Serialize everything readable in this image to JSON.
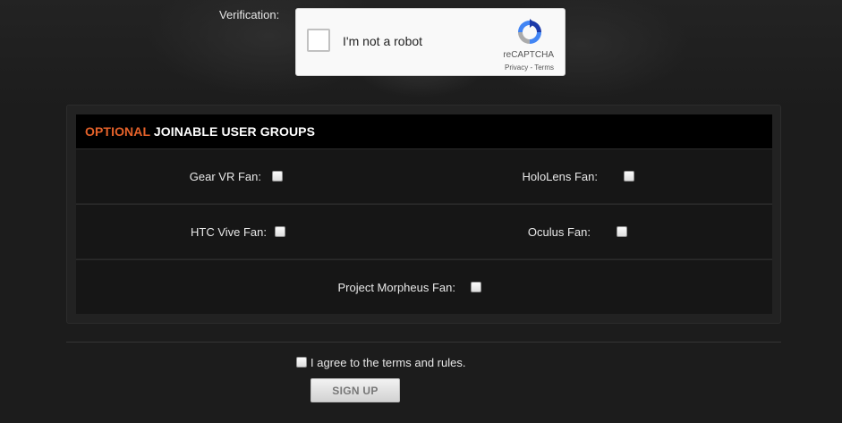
{
  "verification": {
    "label": "Verification:",
    "recaptcha": {
      "checkbox_text": "I'm not a robot",
      "brand": "reCAPTCHA",
      "privacy": "Privacy",
      "separator": " - ",
      "terms": "Terms",
      "logo_icon": "recaptcha-logo-icon"
    }
  },
  "groups": {
    "title_accent": "OPTIONAL",
    "title_rest": "JOINABLE USER GROUPS",
    "accent_color": "#e5622a",
    "items": [
      {
        "label": "Gear VR Fan:",
        "checked": false
      },
      {
        "label": "HoloLens Fan:",
        "checked": false
      },
      {
        "label": "HTC Vive Fan:",
        "checked": false
      },
      {
        "label": "Oculus Fan:",
        "checked": false
      },
      {
        "label": "Project Morpheus Fan:",
        "checked": false
      }
    ]
  },
  "agreement": {
    "prefix": "I agree to the",
    "link": "terms and rules",
    "suffix": ".",
    "checked": false
  },
  "signup_label": "SIGN UP"
}
